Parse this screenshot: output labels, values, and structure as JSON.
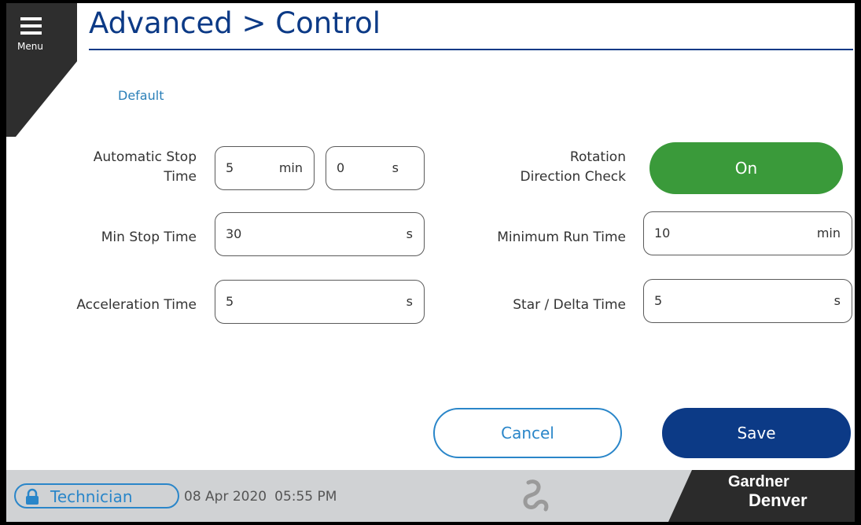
{
  "header": {
    "menu_label": "Menu",
    "title": "Advanced > Control",
    "default_link": "Default"
  },
  "left_fields": {
    "auto_stop": {
      "label_line1": "Automatic Stop",
      "label_line2": "Time",
      "min_value": "5",
      "min_unit": "min",
      "sec_value": "0",
      "sec_unit": "s"
    },
    "min_stop": {
      "label": "Min Stop Time",
      "value": "30",
      "unit": "s"
    },
    "acceleration": {
      "label": "Acceleration Time",
      "value": "5",
      "unit": "s"
    }
  },
  "right_fields": {
    "rotation_check": {
      "label_line1": "Rotation",
      "label_line2": "Direction Check",
      "state": "On"
    },
    "min_run": {
      "label": "Minimum Run Time",
      "value": "10",
      "unit": "min"
    },
    "star_delta": {
      "label": "Star / Delta Time",
      "value": "5",
      "unit": "s"
    }
  },
  "actions": {
    "cancel_label": "Cancel",
    "save_label": "Save"
  },
  "status_bar": {
    "user_role": "Technician",
    "date": "08 Apr 2020",
    "time": "05:55 PM",
    "brand_line1": "Gardner",
    "brand_line2": "Denver"
  },
  "colors": {
    "title_blue": "#0c3a86",
    "accent_blue": "#2a86c9",
    "toggle_green": "#3a9a3a",
    "status_bar_gray": "#d0d2d4",
    "corner_dark": "#2e2e2e"
  },
  "icons": {
    "menu": "hamburger-icon",
    "lock": "lock-icon",
    "status_center": "compressor-status-icon"
  }
}
